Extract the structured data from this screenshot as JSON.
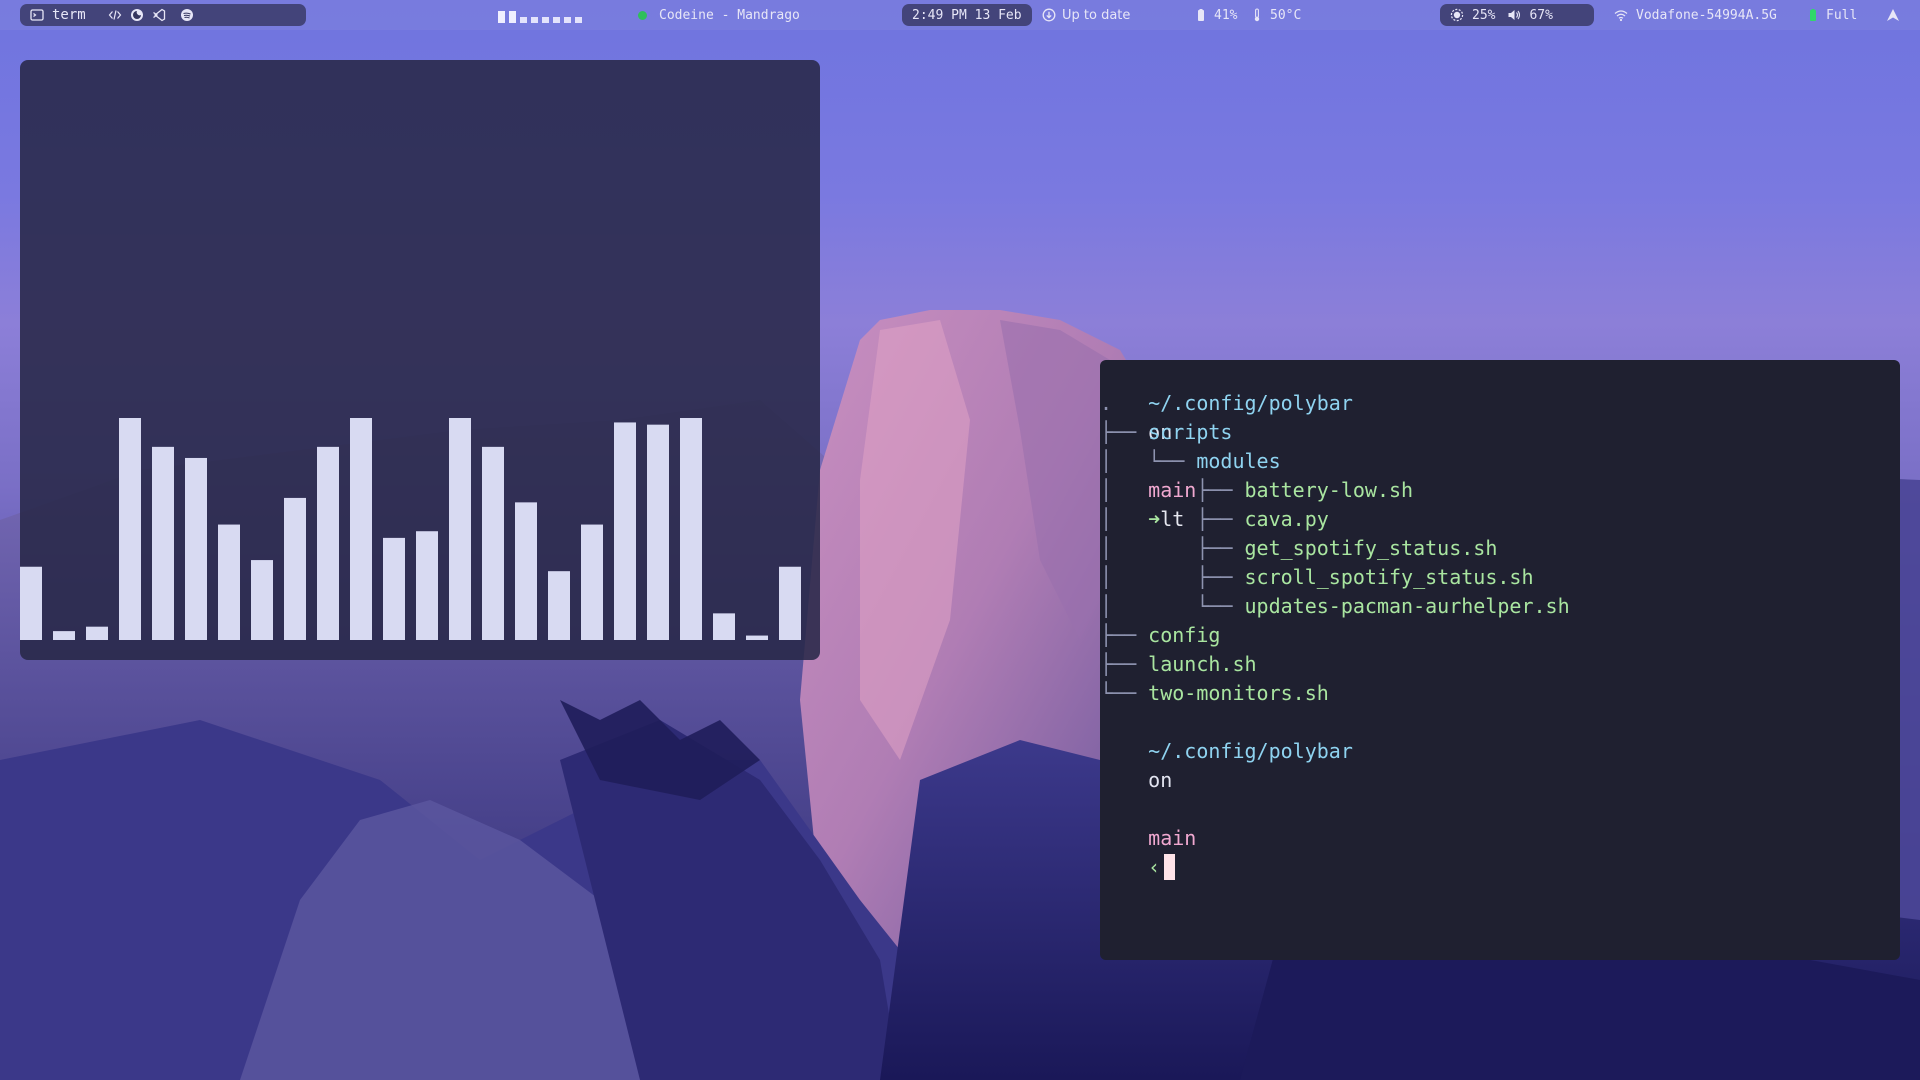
{
  "topbar": {
    "left": {
      "term_icon": "terminal-icon",
      "term_label": "term",
      "app_icons": [
        "code-icon",
        "firefox-icon",
        "vscode-icon",
        "spotify-icon"
      ]
    },
    "workspaces_count": 8,
    "active_workspaces": [
      0,
      1
    ],
    "spotify": {
      "status_color": "#2fbf5a",
      "text": "Codeine - Mandrago"
    },
    "clock": "2:49 PM 13 Feb",
    "updates": "Up to date",
    "battery_pct": "41%",
    "temperature": "50°C",
    "brightness": "25%",
    "volume": "67%",
    "wifi": "Vodafone-54994A.5G",
    "battery_status": "Full"
  },
  "visualizer": {
    "bar_levels": [
      0.33,
      0.04,
      0.06,
      1.0,
      0.87,
      0.82,
      0.52,
      0.36,
      0.64,
      0.87,
      1.0,
      0.46,
      0.49,
      1.0,
      0.87,
      0.62,
      0.31,
      0.52,
      0.98,
      0.97,
      1.0,
      0.12,
      0.02,
      0.33
    ],
    "bar_color": "#d8daf2"
  },
  "terminal": {
    "prompt1": {
      "path": "~/.config/polybar",
      "on": "on",
      "branch_icon": "",
      "branch": "main",
      "arrow": "➜",
      "command": "lt"
    },
    "tree_root": ".",
    "tree": [
      {
        "prefix": "├── ",
        "name": "scripts",
        "kind": "dir"
      },
      {
        "prefix": "│   └── ",
        "name": "modules",
        "kind": "dir"
      },
      {
        "prefix": "│       ├── ",
        "name": "battery-low.sh",
        "kind": "file"
      },
      {
        "prefix": "│       ├── ",
        "name": "cava.py",
        "kind": "file"
      },
      {
        "prefix": "│       ├── ",
        "name": "get_spotify_status.sh",
        "kind": "file"
      },
      {
        "prefix": "│       ├── ",
        "name": "scroll_spotify_status.sh",
        "kind": "file"
      },
      {
        "prefix": "│       └── ",
        "name": "updates-pacman-aurhelper.sh",
        "kind": "file"
      },
      {
        "prefix": "├── ",
        "name": "config",
        "kind": "file"
      },
      {
        "prefix": "├── ",
        "name": "launch.sh",
        "kind": "file"
      },
      {
        "prefix": "└── ",
        "name": "two-monitors.sh",
        "kind": "file"
      }
    ],
    "prompt2": {
      "path": "~/.config/polybar",
      "on": "on",
      "branch_icon": "",
      "branch": "main",
      "arrow": "‹"
    }
  }
}
